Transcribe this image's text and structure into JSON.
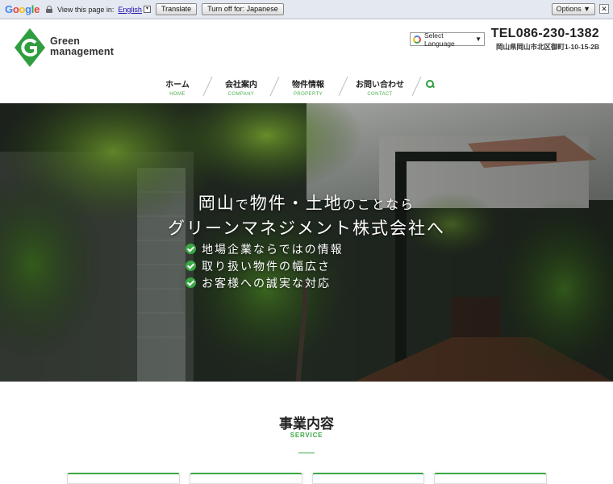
{
  "google_bar": {
    "logo": "Google",
    "view_text": "View this page in:",
    "language": "English",
    "translate_label": "Translate",
    "turn_off_label": "Turn off for: Japanese",
    "options_label": "Options ▼",
    "close_label": "✕"
  },
  "header": {
    "logo_line1": "Green",
    "logo_line2": "management",
    "select_language": "Select Language",
    "select_arrow": "▼",
    "tel": "TEL086-230-1382",
    "address": "岡山県岡山市北区御町1-10-15-2B"
  },
  "nav": [
    {
      "jp": "ホーム",
      "en": "HOME"
    },
    {
      "jp": "会社案内",
      "en": "COMPANY"
    },
    {
      "jp": "物件情報",
      "en": "PROPERTY"
    },
    {
      "jp": "お問い合わせ",
      "en": "CONTACT"
    }
  ],
  "hero": {
    "line1_a": "岡山",
    "line1_b": "で",
    "line1_c": "物件・土地",
    "line1_d": "の",
    "line1_e": "ことなら",
    "line2": "グリーンマネジメント株式会社へ",
    "points": [
      "地場企業ならではの情報",
      "取り扱い物件の幅広さ",
      "お客様への誠実な対応"
    ]
  },
  "service": {
    "title": "事業内容",
    "subtitle": "SERVICE"
  },
  "colors": {
    "accent": "#3aa845",
    "logo": "#2e9e3e"
  }
}
